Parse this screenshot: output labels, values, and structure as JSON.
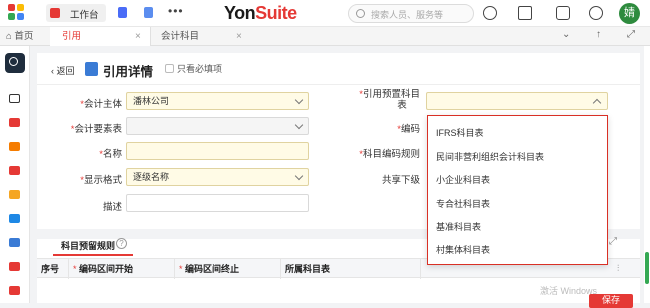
{
  "header": {
    "workspace_label": "工作台",
    "more": "•••",
    "brand_part1": "Yon",
    "brand_part2": "Suite",
    "search_placeholder": "搜索人员、服务等",
    "avatar_text": "婧"
  },
  "tabs": [
    {
      "label": "首页"
    },
    {
      "label": "引用"
    },
    {
      "label": "会计科目"
    }
  ],
  "page": {
    "back_label": "返回",
    "title": "引用详情",
    "required_only_label": "只看必填项"
  },
  "form": {
    "accounting_entity_label": "会计主体",
    "accounting_entity_value": "潘林公司",
    "element_table_label": "会计要素表",
    "code_label": "编码",
    "name_label": "名称",
    "display_format_label": "显示格式",
    "display_format_value": "逐级名称",
    "description_label": "描述",
    "ref_chart_label_line1": "引用预置科目",
    "ref_chart_label_line2": "表",
    "code_rule_label": "科目编码规则",
    "shared_sub_label": "共享下级"
  },
  "dropdown": {
    "options": [
      "IFRS科目表",
      "民间非营利组织会计科目表",
      "小企业科目表",
      "专合社科目表",
      "基准科目表",
      "村集体科目表"
    ]
  },
  "section": {
    "title": "科目预留规则",
    "help": "?",
    "columns": [
      "序号",
      "编码区间开始",
      "编码区间终止",
      "所属科目表"
    ]
  },
  "overlay": {
    "watermark": "激活 Windows",
    "right_button": "保存"
  },
  "colors": {
    "brand_red": "#e53935",
    "required_bg": "#fffbe6",
    "avatar_green": "#2e8b3e",
    "sidebar_dark": "#1f2d3d"
  }
}
